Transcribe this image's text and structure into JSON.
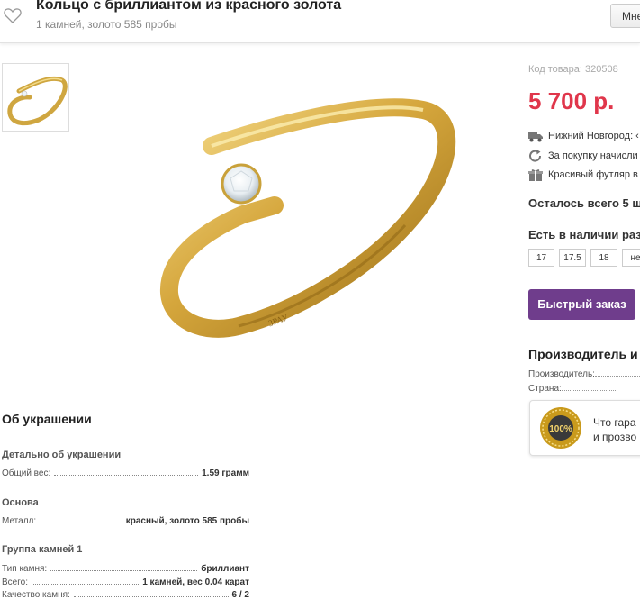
{
  "header": {
    "title": "Кольцо с бриллиантом из красного золота",
    "subtitle": "1 камней, золото 585 пробы",
    "more_label": "Mне"
  },
  "product": {
    "sku": "Код товара: 320508",
    "price": "5 700 р.",
    "features": [
      {
        "icon": "truck-icon",
        "text": "Нижний Новгород: ‹"
      },
      {
        "icon": "refresh-icon",
        "text": "За покупку начисли"
      },
      {
        "icon": "gift-icon",
        "text": "Красивый футляр в"
      }
    ],
    "remaining": "Осталось всего 5 ш",
    "availability": "Есть в наличии раз",
    "sizes": [
      "17",
      "17.5",
      "18",
      "не"
    ],
    "quick_order": "Быстрый заказ"
  },
  "maker": {
    "heading": "Производитель и",
    "rows": [
      {
        "label": "Производитель:"
      },
      {
        "label": "Страна:"
      }
    ],
    "guarantee_line1": "Что гара",
    "guarantee_line2": "и прозво",
    "seal_text": "100%"
  },
  "specs": {
    "heading": "Об украшении",
    "groups": [
      {
        "title": "Детально об украшении",
        "rows": [
          {
            "label": "Общий вес:",
            "value": "1.59 грамм"
          }
        ]
      },
      {
        "title": "Основа",
        "rows": [
          {
            "label": "Металл:",
            "value": "красный, золото 585 пробы"
          }
        ]
      },
      {
        "title": "Группа камней 1",
        "rows": [
          {
            "label": "Тип камня:",
            "value": "бриллиант"
          },
          {
            "label": "Всего:",
            "value": "1 камней, вес 0.04 карат"
          },
          {
            "label": "Качество камня:",
            "value": "6 / 2"
          }
        ]
      }
    ]
  },
  "colors": {
    "price": "#e0364b",
    "button": "#6f3d8c",
    "gold": "#d4a93a"
  }
}
